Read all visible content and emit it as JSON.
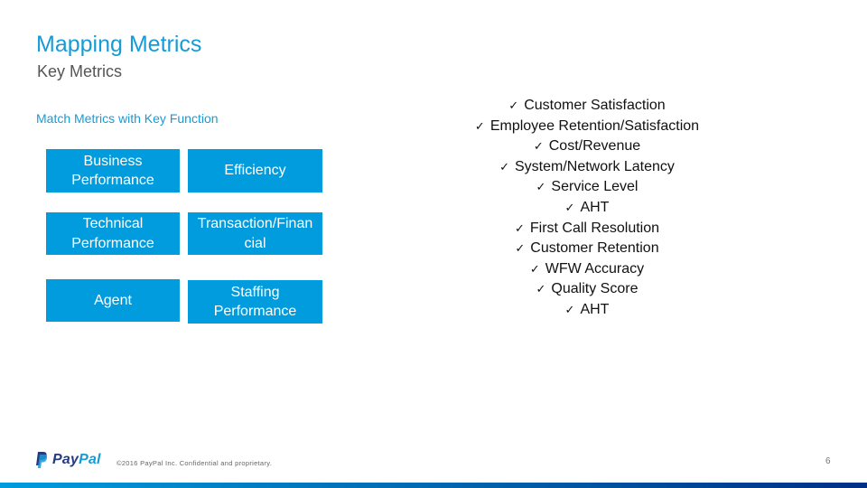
{
  "slide": {
    "title": "Mapping Metrics",
    "subtitle": "Key Metrics",
    "section_label": "Match Metrics with Key Function",
    "page_number": "6"
  },
  "function_boxes": [
    {
      "lines": [
        "Business",
        "Performance"
      ]
    },
    {
      "lines": [
        "Efficiency"
      ]
    },
    {
      "lines": [
        "Technical",
        "Performance"
      ]
    },
    {
      "lines": [
        "Transaction/Finan",
        "cial"
      ]
    },
    {
      "lines": [
        "Agent"
      ]
    },
    {
      "lines": [
        "Staffing",
        "Performance"
      ]
    }
  ],
  "metrics_checklist": {
    "check_glyph": "✓",
    "items": [
      "Customer Satisfaction",
      "Employee Retention/Satisfaction",
      "Cost/Revenue",
      "System/Network Latency",
      "Service Level",
      "AHT",
      "First Call Resolution",
      "Customer Retention",
      "WFW Accuracy",
      "Quality Score",
      "AHT"
    ]
  },
  "footer": {
    "logo_pay": "Pay",
    "logo_pal": "Pal",
    "copyright": "©2016 PayPal Inc. Confidential and proprietary."
  },
  "colors": {
    "accent": "#179bd7",
    "box": "#009cde",
    "paypal_dark": "#253b80",
    "bar_start": "#009cde",
    "bar_end": "#002f86"
  }
}
